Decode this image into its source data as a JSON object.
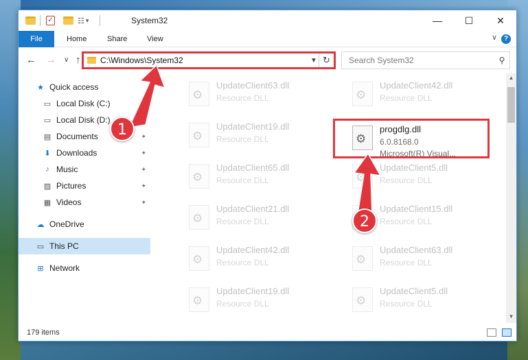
{
  "window": {
    "title": "System32",
    "controls": {
      "minimize": "—",
      "maximize": "☐",
      "close": "✕"
    }
  },
  "quick_access_toolbar": {
    "dropdown": "▾"
  },
  "ribbon": {
    "tabs": [
      "File",
      "Home",
      "Share",
      "View"
    ],
    "help": "?",
    "collapse": "∨"
  },
  "address": {
    "path": "C:\\Windows\\System32",
    "search_placeholder": "Search System32",
    "back": "←",
    "forward": "→",
    "recent": "∨",
    "up": "↑",
    "refresh": "↻"
  },
  "sidebar": {
    "items": [
      {
        "label": "Quick access",
        "icon": "star-icon",
        "glyph": "★",
        "pinned": false,
        "selected": false
      },
      {
        "label": "Local Disk (C:)",
        "icon": "disk-icon",
        "glyph": "▭",
        "pinned": true,
        "selected": false
      },
      {
        "label": "Local Disk (D:)",
        "icon": "disk-icon",
        "glyph": "▭",
        "pinned": true,
        "selected": false
      },
      {
        "label": "Documents",
        "icon": "documents-icon",
        "glyph": "▤",
        "pinned": true,
        "selected": false
      },
      {
        "label": "Downloads",
        "icon": "download-icon",
        "glyph": "⬇",
        "pinned": true,
        "selected": false
      },
      {
        "label": "Music",
        "icon": "music-icon",
        "glyph": "♪",
        "pinned": true,
        "selected": false
      },
      {
        "label": "Pictures",
        "icon": "pictures-icon",
        "glyph": "▨",
        "pinned": true,
        "selected": false
      },
      {
        "label": "Videos",
        "icon": "videos-icon",
        "glyph": "▦",
        "pinned": true,
        "selected": false
      },
      {
        "label": "OneDrive",
        "icon": "cloud-icon",
        "glyph": "☁",
        "pinned": false,
        "selected": false
      },
      {
        "label": "This PC",
        "icon": "computer-icon",
        "glyph": "▭",
        "pinned": false,
        "selected": true
      },
      {
        "label": "Network",
        "icon": "network-icon",
        "glyph": "⊞",
        "pinned": false,
        "selected": false
      }
    ],
    "pin_glyph": "📌"
  },
  "files": {
    "left_column": [
      {
        "name": "UpdateClient63.dll",
        "type": "Resource DLL"
      },
      {
        "name": "UpdateClient19.dll",
        "type": "Resource DLL"
      },
      {
        "name": "UpdateClient65.dll",
        "type": "Resource DLL"
      },
      {
        "name": "UpdateClient21.dll",
        "type": "Resource DLL"
      },
      {
        "name": "UpdateClient42.dll",
        "type": "Resource DLL"
      },
      {
        "name": "UpdateClient19.dll",
        "type": "Resource DLL"
      }
    ],
    "right_column": [
      {
        "name": "UpdateClient42.dll",
        "type": "Resource DLL"
      },
      {
        "name": "UpdateClient5.dll",
        "type": "Resource DLL"
      },
      {
        "name": "UpdateClient15.dll",
        "type": "Resource DLL"
      },
      {
        "name": "UpdateClient63.dll",
        "type": "Resource DLL"
      },
      {
        "name": "UpdateClient5.dll",
        "type": "Resource DLL"
      }
    ],
    "highlighted": {
      "name": "progdlg.dll",
      "version": "6.0.8168.0",
      "company": "Microsoft(R) Visual..."
    }
  },
  "status": {
    "item_count": "179 items"
  },
  "callouts": [
    "1",
    "2"
  ],
  "colors": {
    "accent": "#1979ca",
    "highlight_red": "#e0353d",
    "selected_bg": "#cce4f7"
  }
}
